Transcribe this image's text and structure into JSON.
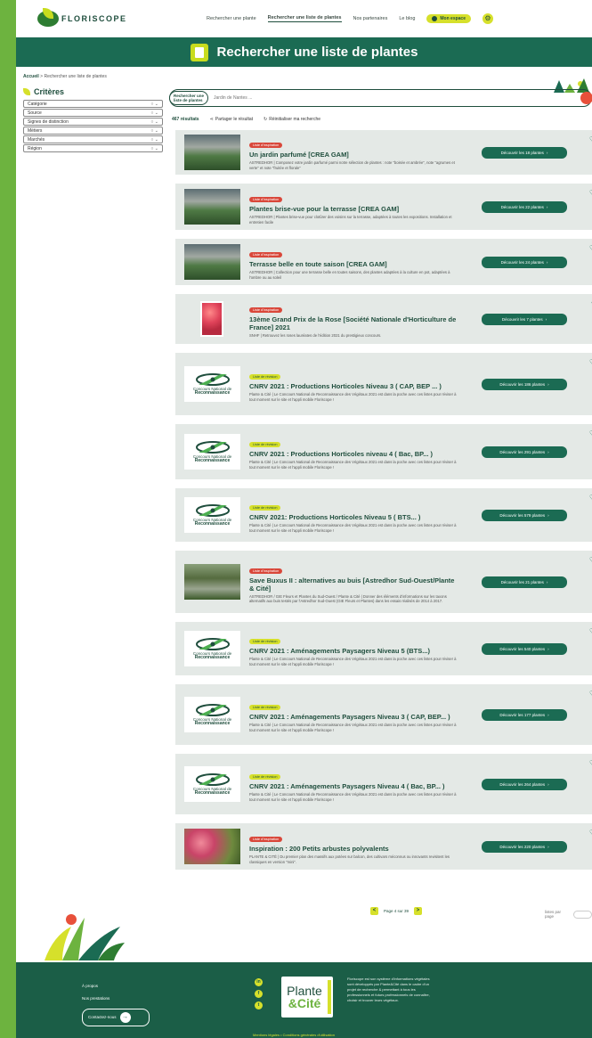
{
  "header": {
    "logo": "FLORISCOPE",
    "nav": [
      "Rechercher une plante",
      "Rechercher une liste de plantes",
      "Nos partenaires",
      "Le blog"
    ],
    "active_nav": 1,
    "space_btn": "Mon espace"
  },
  "banner": {
    "title": "Rechercher une liste de plantes"
  },
  "breadcrumb": {
    "home": "Accueil",
    "sep": " > ",
    "current": "Rechercher une liste de plantes"
  },
  "sidebar": {
    "title": "Critères",
    "criteria": [
      "Catégorie",
      "Source",
      "Signes de distinction",
      "Métiers",
      "Marchés",
      "Région"
    ]
  },
  "search": {
    "tag": "Rechercher une liste de plantes",
    "placeholder": "Jardin de Nantes ..."
  },
  "toolbar": {
    "count": "467 résultats",
    "share": "Partager le résultat",
    "reset": "Réinitialiser ma recherche"
  },
  "results": [
    {
      "badge": "Liste d'inspiration",
      "badge_type": "insp",
      "thumb": "greenhouse",
      "title": "Un jardin parfumé [CREA GAM]",
      "desc": "ASTREDHOR | Composez votre jardin parfumé parmi notre sélection de plantes : note \"boisée et ambrée\", note \"agrumes et verte\" et note \"fruitée et florale\"",
      "cta": "Découvrir les 18 plantes",
      "h": 50,
      "heart": "♡"
    },
    {
      "badge": "Liste d'inspiration",
      "badge_type": "insp",
      "thumb": "greenhouse",
      "title": "Plantes brise-vue pour la terrasse [CREA GAM]",
      "desc": "ASTREDHOR | Plantes brise-vue pour clotûrer des voisins sur la terrasse, adaptées à toutes les expositions. Installation et entretien facile",
      "cta": "Découvrir les 22 plantes",
      "h": 52,
      "heart": "♡"
    },
    {
      "badge": "Liste d'inspiration",
      "badge_type": "insp",
      "thumb": "greenhouse",
      "title": "Terrasse belle en toute saison [CREA GAM]",
      "desc": "ASTREDHOR | Collection pour une terrasse belle en toutes saisons, des plantes adaptées à la culture en pot, adaptées à l'ombre ou au soleil",
      "cta": "Découvrir les 24 plantes",
      "h": 52,
      "heart": "♡"
    },
    {
      "badge": "Liste d'inspiration",
      "badge_type": "insp",
      "thumb": "rose",
      "title": "13ème Grand Prix de la Rose [Société Nationale d'Horticulture de France] 2021",
      "desc": "SNHF | Retrouvez les roses lauréates de l'édition 2021 du prestigieux concours.",
      "cta": "Découvrir les 7 plantes",
      "h": 56,
      "heart": "♥"
    },
    {
      "badge": "Liste de révision",
      "badge_type": "rev",
      "thumb": "cnrv",
      "title": "CNRV 2021 : Productions Horticoles Niveau 3 ( CAP, BEP ... )",
      "desc": "Plante & Cité | Le Concours National de Reconnaissance des Végétaux 2021 est dans la poche avec ces listes pour réviser à tout moment sur le site et l'appli mobile Floriscope !",
      "cta": "Découvrir les 186 plantes",
      "h": 70,
      "heart": "♡"
    },
    {
      "badge": "Liste de révision",
      "badge_type": "rev",
      "thumb": "cnrv",
      "title": "CNRV 2021 : Productions Horticoles niveau 4 ( Bac, BP... )",
      "desc": "Plante & Cité | Le Concours National de Reconnaissance des Végétaux 2021 est dans la poche avec ces listes pour réviser à tout moment sur le site et l'appli mobile Floriscope !",
      "cta": "Découvrir les 291 plantes",
      "h": 62,
      "heart": "♡"
    },
    {
      "badge": "Liste de révision",
      "badge_type": "rev",
      "thumb": "cnrv",
      "title": "CNRV 2021: Productions Horticoles Niveau 5 ( BTS... )",
      "desc": "Plante & Cité | Le Concours National de Reconnaissance des Végétaux 2021 est dans la poche avec ces listes pour réviser à tout moment sur le site et l'appli mobile Floriscope !",
      "cta": "Découvrir les 579 plantes",
      "h": 60,
      "heart": "♡"
    },
    {
      "badge": "Liste d'inspiration",
      "badge_type": "insp",
      "thumb": "garden",
      "title": "Save Buxus II : alternatives au buis [Astredhor Sud-Ouest/Plante & Cité]",
      "desc": "ASTREDHOR / GIE Fleurs et Plantes du Sud-Ouest / Plante & Cité | Donner des éléments d'informations sur les taxons alternatifs aux buis testés par l'Astredhor Sud-Ouest (GIE Fleurs et Plantes) dans les essais réalisés de 2014 à 2017.",
      "cta": "Découvrir les 21 plantes",
      "h": 70,
      "heart": "♡"
    },
    {
      "badge": "Liste de révision",
      "badge_type": "rev",
      "thumb": "cnrv",
      "title": "CNRV 2021 : Aménagements Paysagers Niveau 5 (BTS...)",
      "desc": "Plante & Cité | Le Concours National de Reconnaissance des Végétaux 2021 est dans la poche avec ces listes pour réviser à tout moment sur le site et l'appli mobile Floriscope !",
      "cta": "Découvrir les 540 plantes",
      "h": 60,
      "heart": "♡"
    },
    {
      "badge": "Liste de révision",
      "badge_type": "rev",
      "thumb": "cnrv",
      "title": "CNRV 2021 : Aménagements Paysagers Niveau 3 ( CAP, BEP... )",
      "desc": "Plante & Cité | Le Concours National de Reconnaissance des Végétaux 2021 est dans la poche avec ces listes pour réviser à tout moment sur le site et l'appli mobile Floriscope !",
      "cta": "Découvrir les 177 plantes",
      "h": 68,
      "heart": "♡"
    },
    {
      "badge": "Liste de révision",
      "badge_type": "rev",
      "thumb": "cnrv",
      "title": "CNRV 2021 : Aménagements Paysagers Niveau 4 ( Bac, BP... )",
      "desc": "Plante & Cité | Le Concours National de Reconnaissance des Végétaux 2021 est dans la poche avec ces listes pour réviser à tout moment sur le site et l'appli mobile Floriscope !",
      "cta": "Découvrir les 264 plantes",
      "h": 68,
      "heart": "♡"
    },
    {
      "badge": "Liste d'inspiration",
      "badge_type": "insp",
      "thumb": "shrub",
      "title": "Inspiration : 200 Petits arbustes polyvalents",
      "desc": "PLANTE & CITÉ | Du premier plan des massifs aux potées sur balcon, des cultivars méconnus ou innovants revisitent les classiques en version \"mini\".",
      "cta": "Découvrir les 220 plantes",
      "h": 52,
      "heart": "♡"
    }
  ],
  "cnrv_logo": {
    "line1": "Concours National de",
    "line2": "Reconnaissance"
  },
  "pager": {
    "prev": "<",
    "label": "Page 4 sur 39",
    "next": ">",
    "perpage": "listes par page"
  },
  "footer": {
    "links": [
      "À propos",
      "Nos prestations"
    ],
    "contact": "Contactez-nous",
    "pc_line1": "Plante",
    "pc_line2": "&Cité",
    "desc": "Floriscope est son système d'informations végétales sont développés par Plante&Cité dans le cadre d'un projet de recherche & permettant à tous les professionnels et futurs professionnels de connaître, choisir et trouver leurs végétaux.",
    "legal": "Mentions légales  •  Conditions générales d'utilisation"
  },
  "colors": {
    "primary": "#1b6b53",
    "accent": "#d6e02b",
    "badge_red": "#d9473a",
    "frame": "#6db33f"
  }
}
